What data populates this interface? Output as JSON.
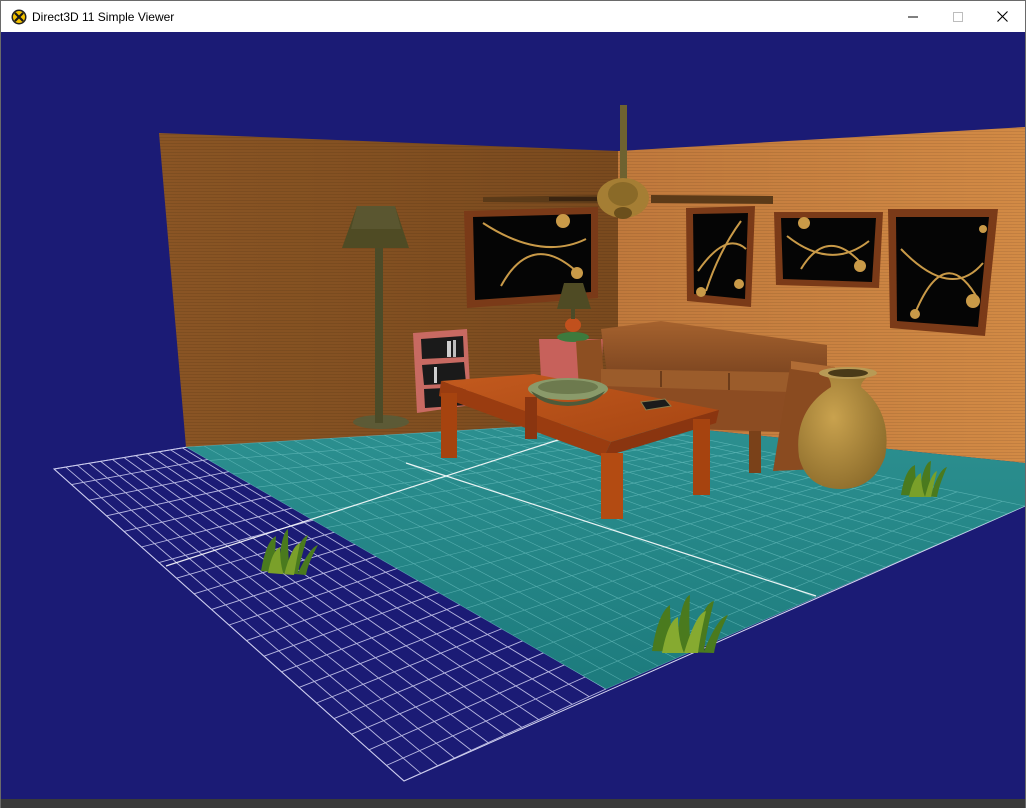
{
  "window": {
    "title": "Direct3D 11 Simple Viewer",
    "app_icon": "directx-x-icon",
    "controls": {
      "minimize_icon": "minimize-icon",
      "maximize_icon": "maximize-icon",
      "close_icon": "close-icon"
    }
  },
  "scene": {
    "background_color": "#1b1b75",
    "objects": [
      "floor-grid",
      "teal-tile-floor",
      "left-wood-wall",
      "back-wood-wall",
      "ceiling-fan",
      "floor-lamp",
      "framed-pictures",
      "bookshelf",
      "side-table-lamp",
      "wicker-sofa",
      "coffee-table",
      "bowl",
      "book",
      "clay-vase",
      "grass-plants"
    ]
  }
}
